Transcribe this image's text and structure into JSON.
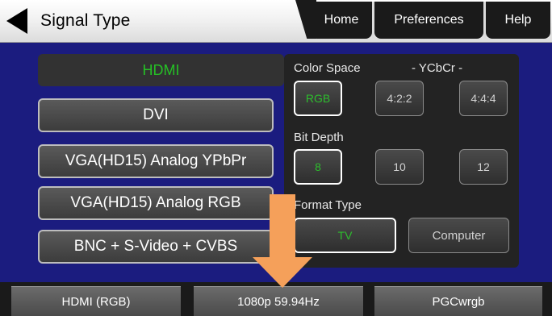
{
  "header": {
    "title": "Signal Type",
    "tabs": {
      "home": "Home",
      "preferences": "Preferences",
      "help": "Help"
    }
  },
  "signal_types": {
    "selected": "HDMI",
    "buttons": [
      "DVI",
      "VGA(HD15) Analog YPbPr",
      "VGA(HD15) Analog RGB",
      "BNC + S-Video + CVBS"
    ]
  },
  "settings": {
    "color_space": {
      "label": "Color Space",
      "ycbcr_label": "- YCbCr -",
      "options": [
        "RGB",
        "4:2:2",
        "4:4:4"
      ],
      "selected": "RGB"
    },
    "bit_depth": {
      "label": "Bit Depth",
      "options": [
        "8",
        "10",
        "12"
      ],
      "selected": "8"
    },
    "format_type": {
      "label": "Format Type",
      "options": [
        "TV",
        "Computer"
      ],
      "selected": "TV"
    }
  },
  "status_bar": {
    "interface": "HDMI (RGB)",
    "timing": "1080p 59.94Hz",
    "pattern": "PGCwrgb"
  },
  "colors": {
    "background": "#1b1c7f",
    "selected_text": "#2dbd2d",
    "arrow": "#f5a05a"
  }
}
